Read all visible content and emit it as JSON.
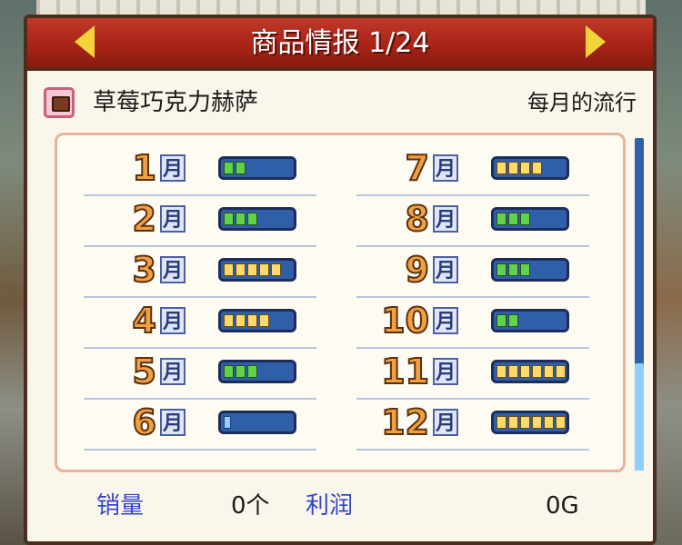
{
  "header": {
    "title": "商品情报 1/24",
    "prev_icon": "left-arrow-icon",
    "next_icon": "right-arrow-icon"
  },
  "item": {
    "name": "草莓巧克力赫萨",
    "icon": "cake-icon"
  },
  "trend_label": "每月的流行",
  "month_suffix": "月",
  "months": [
    {
      "num": "1",
      "level": 2,
      "style": "green"
    },
    {
      "num": "2",
      "level": 3,
      "style": "green"
    },
    {
      "num": "3",
      "level": 5,
      "style": "yellow"
    },
    {
      "num": "4",
      "level": 4,
      "style": "yellow"
    },
    {
      "num": "5",
      "level": 3,
      "style": "green"
    },
    {
      "num": "6",
      "level": 1,
      "style": "blue"
    },
    {
      "num": "7",
      "level": 4,
      "style": "yellow"
    },
    {
      "num": "8",
      "level": 3,
      "style": "green"
    },
    {
      "num": "9",
      "level": 3,
      "style": "green"
    },
    {
      "num": "10",
      "level": 2,
      "style": "green"
    },
    {
      "num": "11",
      "level": 6,
      "style": "yellow"
    },
    {
      "num": "12",
      "level": 6,
      "style": "yellow"
    }
  ],
  "footer": {
    "sales_label": "销量",
    "sales_value": "0个",
    "profit_label": "利润",
    "profit_value": "0G"
  },
  "colors": {
    "title_bar": "#a82416",
    "arrow": "#f4d33a",
    "bar_green": "#5fd44a",
    "bar_yellow": "#ffd96a",
    "bar_blue": "#8fd0ff",
    "footer_label": "#3247c8"
  }
}
